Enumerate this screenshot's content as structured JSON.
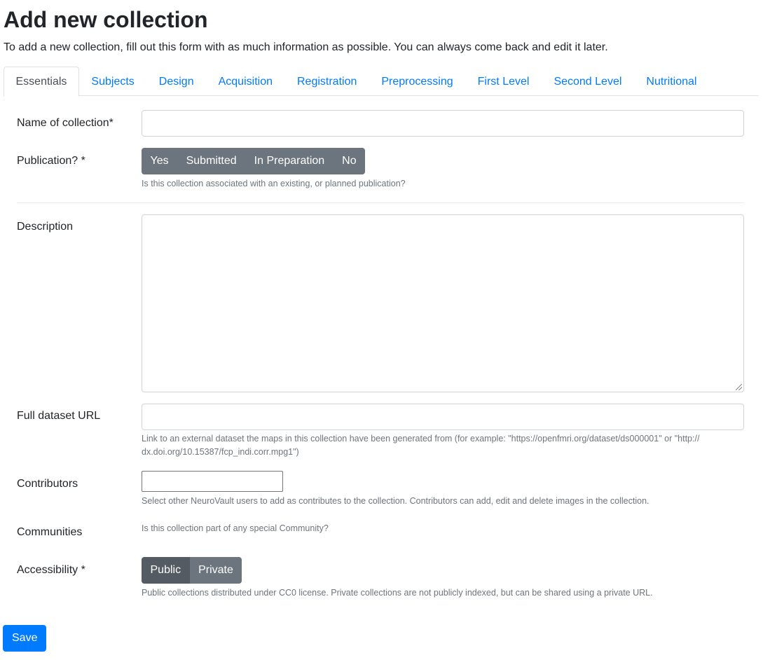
{
  "page": {
    "title": "Add new collection",
    "lead": "To add a new collection, fill out this form with as much information as possible. You can always come back and edit it later."
  },
  "tabs": [
    {
      "label": "Essentials",
      "active": true
    },
    {
      "label": "Subjects"
    },
    {
      "label": "Design"
    },
    {
      "label": "Acquisition"
    },
    {
      "label": "Registration"
    },
    {
      "label": "Preprocessing"
    },
    {
      "label": "First Level"
    },
    {
      "label": "Second Level"
    },
    {
      "label": "Nutritional"
    }
  ],
  "form": {
    "name": {
      "label": "Name of collection*",
      "value": ""
    },
    "publication": {
      "label": "Publication? *",
      "options": [
        "Yes",
        "Submitted",
        "In Preparation",
        "No"
      ],
      "help": "Is this collection associated with an existing, or planned publication?"
    },
    "description": {
      "label": "Description",
      "value": ""
    },
    "dataset_url": {
      "label": "Full dataset URL",
      "value": "",
      "help_line1": "Link to an external dataset the maps in this collection have been generated from (for example: \"https://openfmri.org/dataset/ds000001\" or \"http://",
      "help_line2": "dx.doi.org/10.15387/fcp_indi.corr.mpg1\")"
    },
    "contributors": {
      "label": "Contributors",
      "value": "",
      "help": "Select other NeuroVault users to add as contributes to the collection. Contributors can add, edit and delete images in the collection."
    },
    "communities": {
      "label": "Communities",
      "help": "Is this collection part of any special Community?"
    },
    "accessibility": {
      "label": "Accessibility *",
      "options": [
        "Public",
        "Private"
      ],
      "selected": "Public",
      "help": "Public collections distributed under CC0 license. Private collections are not publicly indexed, but can be shared using a private URL."
    },
    "save_label": "Save"
  },
  "colors": {
    "link": "#007bff",
    "secondary": "#6c757d",
    "secondary_active": "#545b62",
    "primary": "#007bff"
  }
}
